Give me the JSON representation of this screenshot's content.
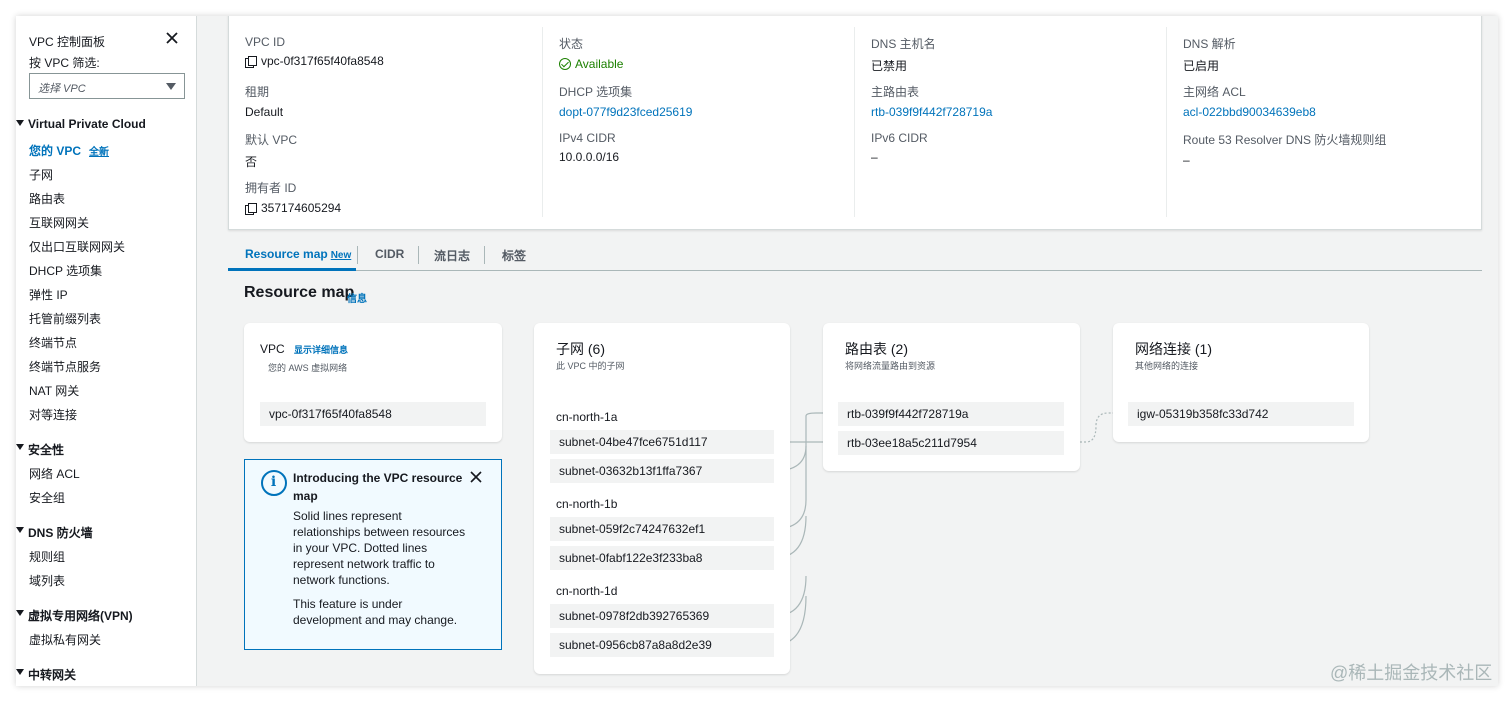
{
  "sidebar": {
    "title": "VPC 控制面板",
    "filter_label": "按 VPC 筛选:",
    "filter_placeholder": "选择 VPC",
    "groups": [
      {
        "label": "Virtual Private Cloud"
      },
      {
        "label": "安全性"
      },
      {
        "label": "DNS 防火墙"
      },
      {
        "label": "虚拟专用网络(VPN)"
      },
      {
        "label": "中转网关"
      }
    ],
    "your_vpcs": {
      "label": "您的 VPC",
      "badge": "全新"
    },
    "items": [
      "子网",
      "路由表",
      "互联网网关",
      "仅出口互联网网关",
      "DHCP 选项集",
      "弹性 IP",
      "托管前缀列表",
      "终端节点",
      "终端节点服务",
      "NAT 网关",
      "对等连接",
      "网络 ACL",
      "安全组",
      "规则组",
      "域列表",
      "虚拟私有网关"
    ]
  },
  "details": {
    "vpc_id": {
      "label": "VPC ID",
      "value": "vpc-0f317f65f40fa8548"
    },
    "tenancy": {
      "label": "租期",
      "value": "Default"
    },
    "default_vpc": {
      "label": "默认 VPC",
      "value": "否"
    },
    "owner_id": {
      "label": "拥有者 ID",
      "value": "357174605294"
    },
    "state": {
      "label": "状态",
      "value": "Available"
    },
    "dhcp": {
      "label": "DHCP 选项集",
      "value": "dopt-077f9d23fced25619"
    },
    "ipv4": {
      "label": "IPv4 CIDR",
      "value": "10.0.0.0/16"
    },
    "dns_hostnames": {
      "label": "DNS 主机名",
      "value": "已禁用"
    },
    "main_rt": {
      "label": "主路由表",
      "value": "rtb-039f9f442f728719a"
    },
    "ipv6": {
      "label": "IPv6 CIDR",
      "value": "–"
    },
    "dns_resolution": {
      "label": "DNS 解析",
      "value": "已启用"
    },
    "main_acl": {
      "label": "主网络 ACL",
      "value": "acl-022bbd90034639eb8"
    },
    "route53": {
      "label": "Route 53 Resolver DNS 防火墙规则组",
      "value": "–"
    }
  },
  "tabs": [
    {
      "label": "Resource map",
      "badge": "New"
    },
    {
      "label": "CIDR"
    },
    {
      "label": "流日志"
    },
    {
      "label": "标签"
    }
  ],
  "resource_map": {
    "title": "Resource map",
    "info": "信息",
    "vpc_card": {
      "title": "VPC",
      "detail_link": "显示详细信息",
      "subtitle": "您的 AWS 虚拟网络",
      "vpc": "vpc-0f317f65f40fa8548"
    },
    "subnets_card": {
      "title": "子网 (6)",
      "subtitle": "此 VPC 中的子网",
      "zones": [
        {
          "name": "cn-north-1a",
          "subnets": [
            "subnet-04be47fce6751d117",
            "subnet-03632b13f1ffa7367"
          ]
        },
        {
          "name": "cn-north-1b",
          "subnets": [
            "subnet-059f2c74247632ef1",
            "subnet-0fabf122e3f233ba8"
          ]
        },
        {
          "name": "cn-north-1d",
          "subnets": [
            "subnet-0978f2db392765369",
            "subnet-0956cb87a8a8d2e39"
          ]
        }
      ]
    },
    "routes_card": {
      "title": "路由表 (2)",
      "subtitle": "将网络流量路由到资源",
      "items": [
        "rtb-039f9f442f728719a",
        "rtb-03ee18a5c211d7954"
      ]
    },
    "network_card": {
      "title": "网络连接 (1)",
      "subtitle": "其他网络的连接",
      "items": [
        "igw-05319b358fc33d742"
      ]
    }
  },
  "info_box": {
    "title": "Introducing the VPC resource map",
    "body1": "Solid lines represent relationships between resources in your VPC. Dotted lines represent network traffic to network functions.",
    "body2": "This feature is under development and may change."
  },
  "watermark": "@稀土掘金技术社区",
  "colors": {
    "link": "#0073bb",
    "available": "#1d8102",
    "info_border": "#0073bb",
    "chip_bg": "#f2f3f3"
  }
}
